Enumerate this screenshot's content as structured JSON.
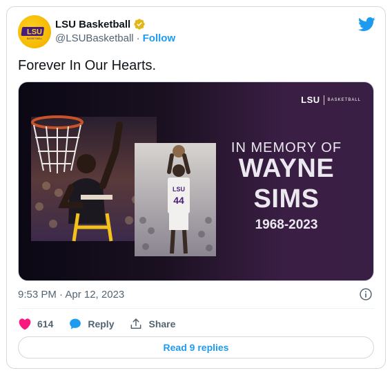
{
  "account": {
    "display_name": "LSU Basketball",
    "handle": "@LSUBasketball",
    "separator": "·",
    "follow_label": "Follow",
    "avatar_text": "LSU",
    "avatar_subtext": "BASKETBALL"
  },
  "tweet": {
    "text": "Forever In Our Hearts."
  },
  "media": {
    "logo_text": "LSU",
    "logo_sub": "BASKETBALL",
    "line1": "IN MEMORY OF",
    "line2": "WAYNE",
    "line3": "SIMS",
    "line4": "1968-2023",
    "jersey_number": "44",
    "jersey_text": "LSU"
  },
  "meta": {
    "timestamp": "9:53 PM · Apr 12, 2023"
  },
  "actions": {
    "like_count": "614",
    "reply_label": "Reply",
    "share_label": "Share"
  },
  "footer": {
    "read_replies": "Read 9 replies"
  },
  "colors": {
    "twitter_blue": "#1d9bf0",
    "like_red": "#f91880",
    "lsu_gold": "#fdd023",
    "lsu_purple": "#461d7c",
    "verified_gold": "#e2b719"
  },
  "icons": [
    "verified-badge-icon",
    "twitter-bird-icon",
    "info-icon",
    "heart-icon",
    "reply-bubble-icon",
    "share-icon"
  ]
}
